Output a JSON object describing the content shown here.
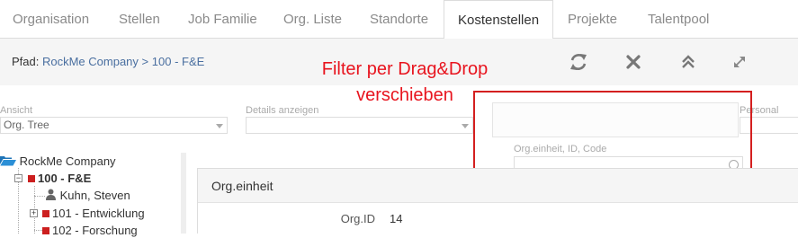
{
  "tabs": [
    {
      "label": "Organisation"
    },
    {
      "label": "Stellen"
    },
    {
      "label": "Job Familie"
    },
    {
      "label": "Org. Liste"
    },
    {
      "label": "Standorte"
    },
    {
      "label": "Kostenstellen",
      "active": true
    },
    {
      "label": "Projekte"
    },
    {
      "label": "Talentpool"
    }
  ],
  "path": {
    "label": "Pfad:",
    "root": "RockMe Company",
    "separator": ">",
    "current": "100 - F&E"
  },
  "toolbar": {
    "icons": [
      "refresh-icon",
      "close-icon",
      "collapse-up-icon",
      "expand-arrows-icon"
    ]
  },
  "annotation": {
    "line1": "Filter per Drag&Drop",
    "line2": "verschieben",
    "color": "#e8141e"
  },
  "filters": {
    "ansicht_label": "Ansicht",
    "ansicht_value": "Org. Tree",
    "details_label": "Details anzeigen",
    "details_value": "",
    "personal_label": "Personal",
    "search_label": "Org.einheit, ID, Code",
    "search_value": ""
  },
  "tree": {
    "root": "RockMe Company",
    "nodes": [
      {
        "label": "100 - F&E"
      },
      {
        "label": "Kuhn, Steven"
      },
      {
        "label": "101 - Entwicklung"
      },
      {
        "label": "102 - Forschung"
      }
    ]
  },
  "detail": {
    "title": "Org.einheit",
    "fields": [
      {
        "key": "Org.ID",
        "value": "14"
      }
    ]
  },
  "colors": {
    "accent_link": "#4a6fa0",
    "node_red": "#cc1f1f",
    "folder_blue": "#1f75b8"
  }
}
